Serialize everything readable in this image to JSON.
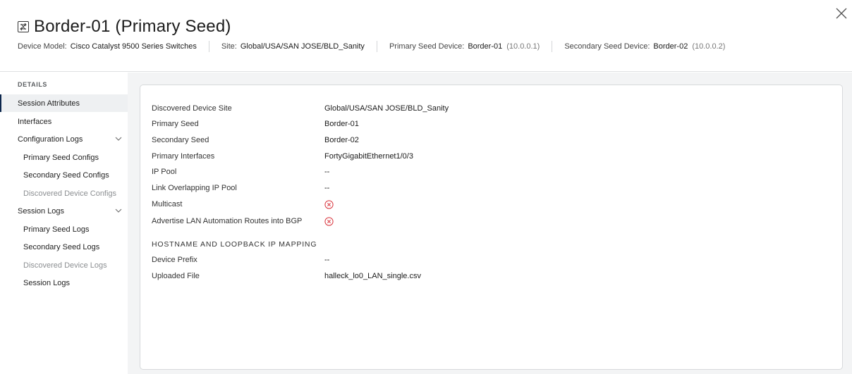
{
  "header": {
    "title": "Border-01 (Primary Seed)",
    "device_icon": "switch-icon",
    "meta": [
      {
        "label": "Device Model:",
        "value": "Cisco Catalyst 9500 Series Switches",
        "ip": ""
      },
      {
        "label": "Site:",
        "value": "Global/USA/SAN JOSE/BLD_Sanity",
        "ip": ""
      },
      {
        "label": "Primary Seed Device:",
        "value": "Border-01",
        "ip": "(10.0.0.1)"
      },
      {
        "label": "Secondary Seed Device:",
        "value": "Border-02",
        "ip": "(10.0.0.2)"
      }
    ],
    "close_icon": "close-icon"
  },
  "sidebar": {
    "heading": "DETAILS",
    "items": [
      {
        "label": "Session Attributes"
      },
      {
        "label": "Interfaces"
      },
      {
        "label": "Configuration Logs"
      },
      {
        "label": "Primary Seed Configs"
      },
      {
        "label": "Secondary Seed Configs"
      },
      {
        "label": "Discovered Device Configs"
      },
      {
        "label": "Session Logs"
      },
      {
        "label": "Primary Seed Logs"
      },
      {
        "label": "Secondary Seed Logs"
      },
      {
        "label": "Discovered Device Logs"
      },
      {
        "label": "Session Logs"
      }
    ]
  },
  "details": {
    "rows": [
      {
        "label": "Discovered Device Site",
        "value": "Global/USA/SAN JOSE/BLD_Sanity"
      },
      {
        "label": "Primary Seed",
        "value": "Border-01"
      },
      {
        "label": "Secondary Seed",
        "value": "Border-02"
      },
      {
        "label": "Primary Interfaces",
        "value": "FortyGigabitEthernet1/0/3"
      },
      {
        "label": "IP Pool",
        "value": "--"
      },
      {
        "label": "Link Overlapping IP Pool",
        "value": "--"
      },
      {
        "label": "Multicast",
        "value": ""
      },
      {
        "label": "Advertise LAN Automation Routes into BGP",
        "value": ""
      }
    ],
    "section_title": "Hostname and Loopback IP Mapping",
    "mapping_rows": [
      {
        "label": "Device Prefix",
        "value": "--"
      },
      {
        "label": "Uploaded File",
        "value": "halleck_lo0_LAN_single.csv"
      }
    ],
    "status_color": "#d9363e"
  },
  "colors": {
    "accent": "#0d274d",
    "background": "#f3f4f5",
    "disabled_text": "#8c8f92"
  }
}
